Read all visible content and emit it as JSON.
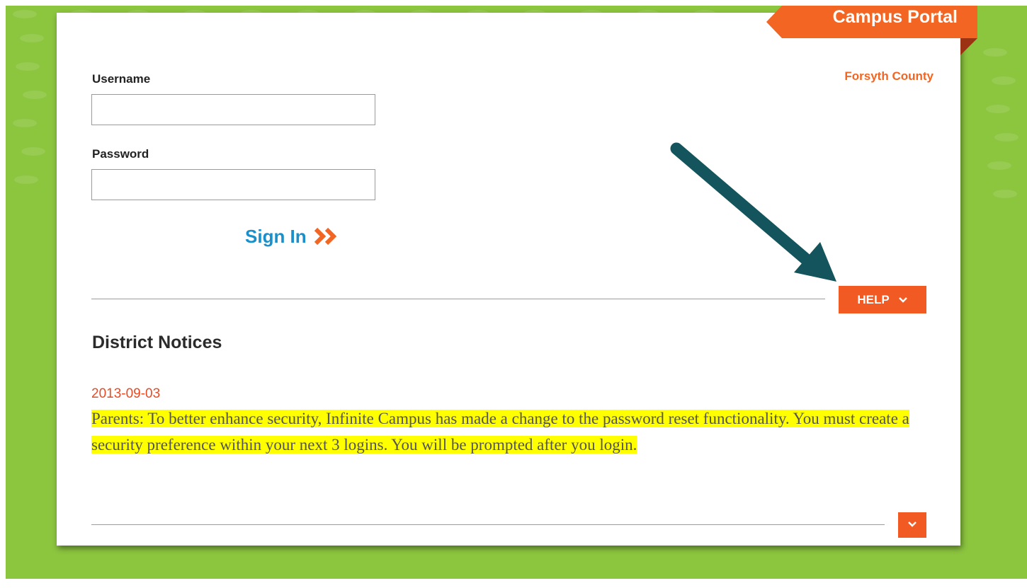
{
  "portal": {
    "title": "Campus Portal",
    "district": "Forsyth County"
  },
  "login": {
    "username_label": "Username",
    "username_value": "",
    "password_label": "Password",
    "password_value": "",
    "sign_in_label": "Sign In",
    "sign_in_icon": "double-chevron-right-icon"
  },
  "help": {
    "label": "HELP",
    "icon": "chevron-down-icon"
  },
  "notices": {
    "heading": "District Notices",
    "items": [
      {
        "date": "2013-09-03",
        "text": " Parents:  To better enhance security, Infinite Campus has made a change to the password reset functionality.  You must create a security preference within your next 3 logins. You will be prompted after you login."
      }
    ],
    "expand_icon": "chevron-down-icon"
  },
  "colors": {
    "background_green": "#8cc63f",
    "accent_orange": "#f26522",
    "link_blue": "#1a8fc9",
    "highlight_yellow": "#ffff00",
    "annotation_arrow": "#14545c"
  }
}
